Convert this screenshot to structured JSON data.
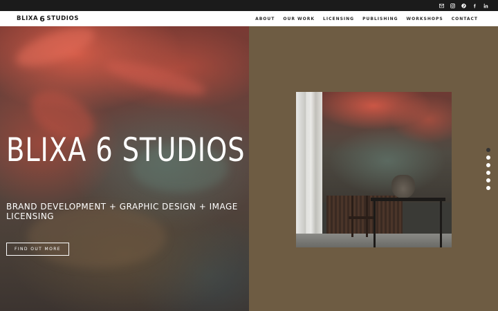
{
  "topbar": {
    "social": [
      {
        "name": "email-icon",
        "glyph": "envelope"
      },
      {
        "name": "instagram-icon",
        "glyph": "instagram"
      },
      {
        "name": "pinterest-icon",
        "glyph": "pinterest"
      },
      {
        "name": "facebook-icon",
        "glyph": "facebook"
      },
      {
        "name": "linkedin-icon",
        "glyph": "linkedin"
      }
    ]
  },
  "header": {
    "logo_left": "BLIXA",
    "logo_six": "6",
    "logo_right": "STUDIOS",
    "nav": [
      "ABOUT",
      "OUR WORK",
      "LICENSING",
      "PUBLISHING",
      "WORKSHOPS",
      "CONTACT"
    ]
  },
  "hero": {
    "title": "BLIXA 6 STUDIOS",
    "subtitle": "BRAND DEVELOPMENT + GRAPHIC DESIGN + IMAGE LICENSING",
    "button": "FIND OUT MORE"
  },
  "slider": {
    "dot_count": 6,
    "active_index": 0
  },
  "colors": {
    "topbar": "#1b1b1b",
    "header": "#ffffff",
    "right_panel": "#6e5c43",
    "text_light": "#ffffff",
    "dot_active": "#333333"
  }
}
